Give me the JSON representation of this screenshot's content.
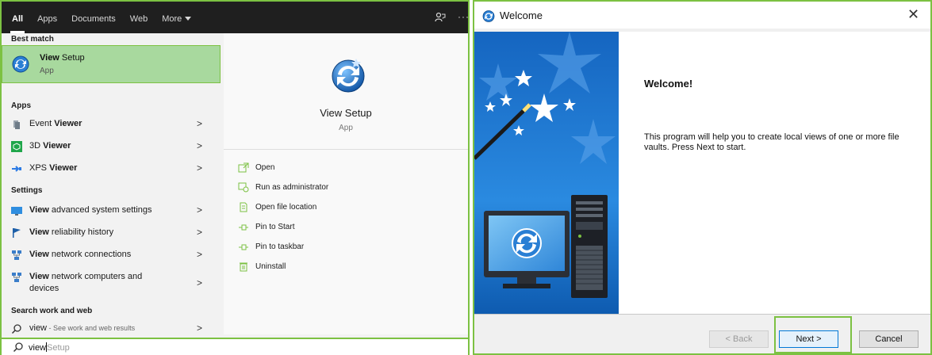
{
  "search": {
    "tabs": [
      {
        "label": "All"
      },
      {
        "label": "Apps"
      },
      {
        "label": "Documents"
      },
      {
        "label": "Web"
      },
      {
        "label": "More"
      }
    ],
    "more_dots": "···",
    "sections": {
      "best_match": "Best match",
      "apps": "Apps",
      "settings": "Settings",
      "web": "Search work and web"
    },
    "best_match": {
      "title_bold": "View",
      "title_rest": " Setup",
      "subtitle": "App"
    },
    "apps": [
      {
        "pre": "Event ",
        "bold": "Viewer",
        "post": ""
      },
      {
        "pre": "3D ",
        "bold": "Viewer",
        "post": ""
      },
      {
        "pre": "XPS ",
        "bold": "Viewer",
        "post": ""
      }
    ],
    "settings": [
      {
        "bold": "View",
        "rest": " advanced system settings"
      },
      {
        "bold": "View",
        "rest": " reliability history"
      },
      {
        "bold": "View",
        "rest": " network connections"
      },
      {
        "bold": "View",
        "rest": " network computers and",
        "line2": "devices"
      }
    ],
    "web_result": {
      "query": "view",
      "hint": " - See work and web results"
    },
    "chevron": ">",
    "preview": {
      "title": "View Setup",
      "subtitle": "App",
      "actions": [
        {
          "label": "Open",
          "icon": "open-icon"
        },
        {
          "label": "Run as administrator",
          "icon": "shield-run-icon"
        },
        {
          "label": "Open file location",
          "icon": "file-location-icon"
        },
        {
          "label": "Pin to Start",
          "icon": "pin-icon"
        },
        {
          "label": "Pin to taskbar",
          "icon": "pin-icon"
        },
        {
          "label": "Uninstall",
          "icon": "trash-icon"
        }
      ]
    },
    "query": {
      "typed": "view",
      "suggestion": "Setup"
    }
  },
  "dialog": {
    "title": "Welcome",
    "close": "✕",
    "heading": "Welcome!",
    "description": "This program will help you to create local views of one or more file vaults. Press Next to start.",
    "buttons": {
      "back": "< Back",
      "next": "Next >",
      "cancel": "Cancel"
    }
  },
  "colors": {
    "highlight": "#7cc142",
    "banner_blue": "#1a6fc1",
    "selected_bg": "#a8d99e"
  }
}
